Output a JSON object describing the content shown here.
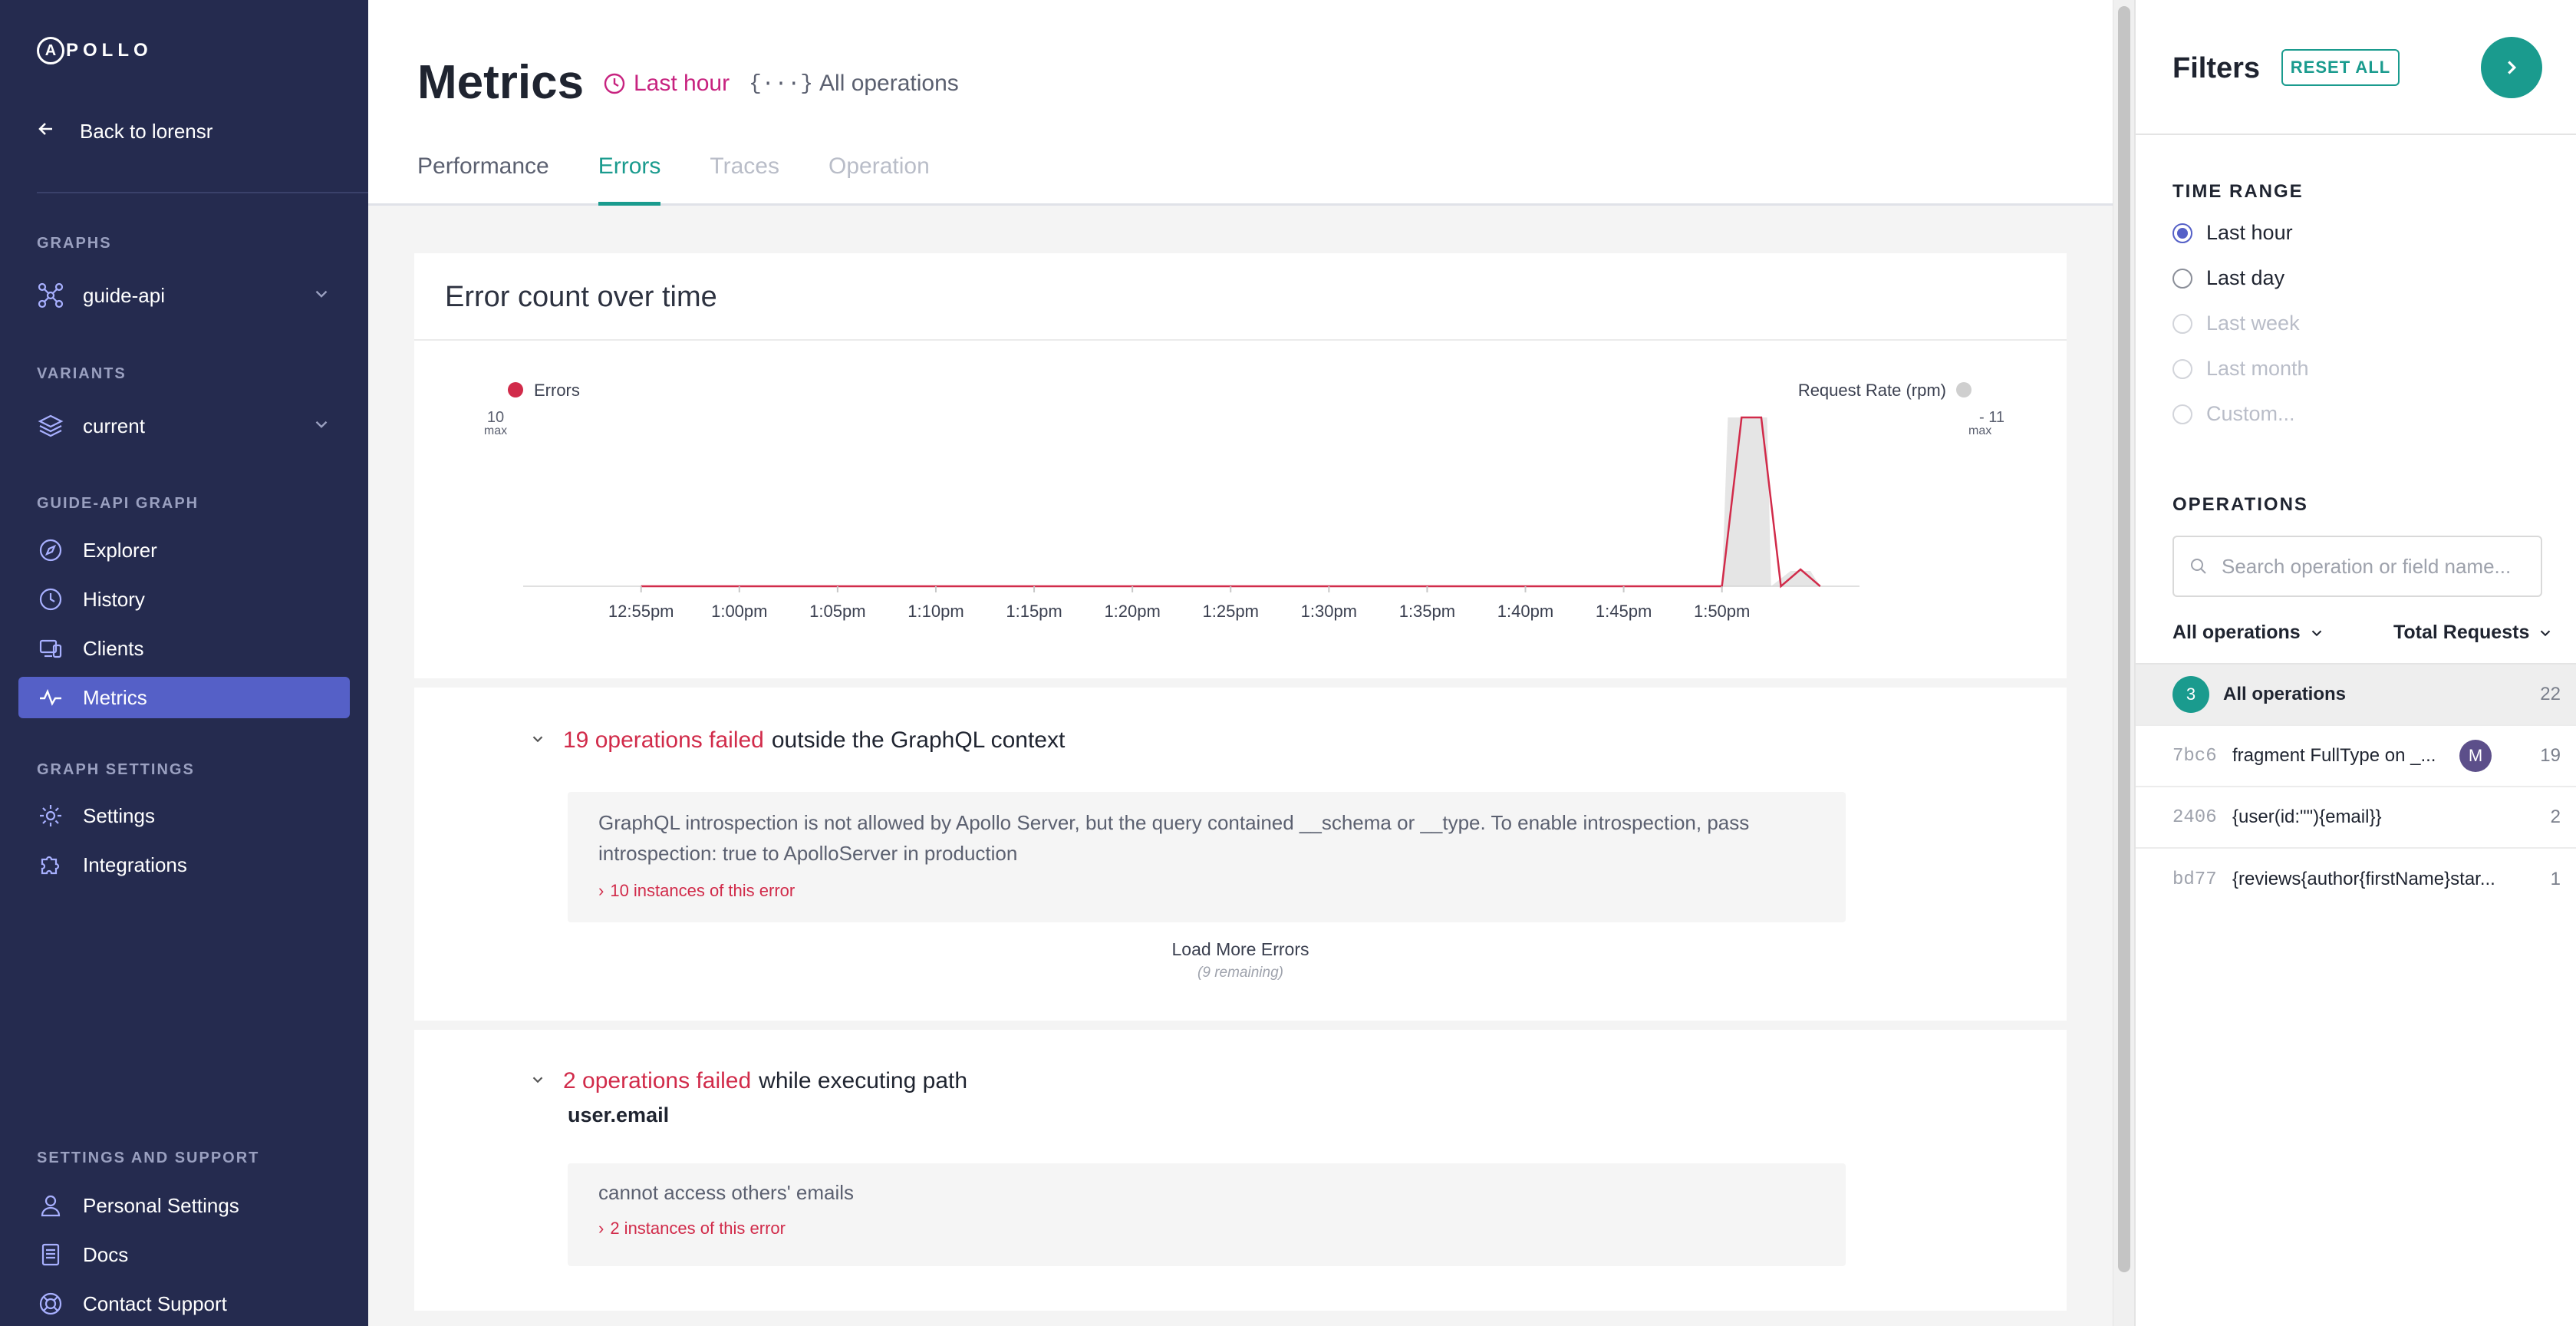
{
  "sidebar": {
    "logo": "APOLLO",
    "back_label": "Back to lorensr",
    "graphs_section": "GRAPHS",
    "graph_name": "guide-api",
    "variants_section": "VARIANTS",
    "variant_name": "current",
    "graph_section": "GUIDE-API GRAPH",
    "nav": [
      {
        "label": "Explorer"
      },
      {
        "label": "History"
      },
      {
        "label": "Clients"
      },
      {
        "label": "Metrics"
      }
    ],
    "settings_section": "GRAPH SETTINGS",
    "settings_nav": [
      {
        "label": "Settings"
      },
      {
        "label": "Integrations"
      }
    ],
    "support_section": "SETTINGS AND SUPPORT",
    "support_nav": [
      {
        "label": "Personal Settings"
      },
      {
        "label": "Docs"
      },
      {
        "label": "Contact Support"
      }
    ]
  },
  "header": {
    "title": "Metrics",
    "time_range": "Last hour",
    "operations": "All operations",
    "tabs": [
      {
        "label": "Performance"
      },
      {
        "label": "Errors"
      },
      {
        "label": "Traces"
      },
      {
        "label": "Operation"
      }
    ]
  },
  "chart_card": {
    "title": "Error count over time"
  },
  "chart_data": {
    "type": "line",
    "legend_left": "Errors",
    "legend_right": "Request Rate (rpm)",
    "y_left_max_value": "10",
    "y_left_max_label": "max",
    "y_right_max_value": "11",
    "y_right_max_label": "max",
    "x_ticks": [
      "12:55pm",
      "1:00pm",
      "1:05pm",
      "1:10pm",
      "1:15pm",
      "1:20pm",
      "1:25pm",
      "1:30pm",
      "1:35pm",
      "1:40pm",
      "1:45pm",
      "1:50pm"
    ],
    "series": [
      {
        "name": "Errors",
        "color": "#d12b4a",
        "points": [
          [
            0,
            0
          ],
          [
            55,
            0
          ],
          [
            56,
            10
          ],
          [
            57,
            10
          ],
          [
            58,
            0
          ],
          [
            59,
            1
          ],
          [
            60,
            0
          ]
        ]
      },
      {
        "name": "Request Rate (rpm)",
        "color": "#cfcfcf",
        "points": [
          [
            0,
            0
          ],
          [
            55,
            0
          ],
          [
            55.3,
            11
          ],
          [
            57.3,
            11
          ],
          [
            57.5,
            0
          ],
          [
            58.5,
            1
          ],
          [
            59.5,
            1
          ],
          [
            60,
            0
          ]
        ]
      }
    ]
  },
  "error_group_1": {
    "count": "19 operations failed",
    "suffix": "outside the GraphQL context",
    "message": "GraphQL introspection is not allowed by Apollo Server, but the query contained __schema or __type. To enable introspection, pass introspection: true to ApolloServer in production",
    "instances": "10 instances of this error",
    "load_more": "Load More Errors",
    "remaining": "(9 remaining)"
  },
  "error_group_2": {
    "count": "2 operations failed",
    "suffix": "while executing path",
    "path": "user.email",
    "message": "cannot access others' emails",
    "instances": "2 instances of this error"
  },
  "filters": {
    "title": "Filters",
    "reset_label": "RESET ALL",
    "time_range_section": "TIME RANGE",
    "time_options": [
      {
        "label": "Last hour"
      },
      {
        "label": "Last day"
      },
      {
        "label": "Last week"
      },
      {
        "label": "Last month"
      },
      {
        "label": "Custom..."
      }
    ],
    "operations_section": "OPERATIONS",
    "search_placeholder": "Search operation or field name...",
    "ops_select": "All operations",
    "sort_select": "Total Requests",
    "operations": [
      {
        "badge": "3",
        "id": "",
        "name": "All operations",
        "count": "22"
      },
      {
        "id": "7bc6",
        "name": "fragment FullType on _...",
        "avatar": "M",
        "count": "19"
      },
      {
        "id": "2406",
        "name": "{user(id:\"\"){email}}",
        "count": "2"
      },
      {
        "id": "bd77",
        "name": "{reviews{author{firstName}star...",
        "count": "1"
      }
    ]
  }
}
